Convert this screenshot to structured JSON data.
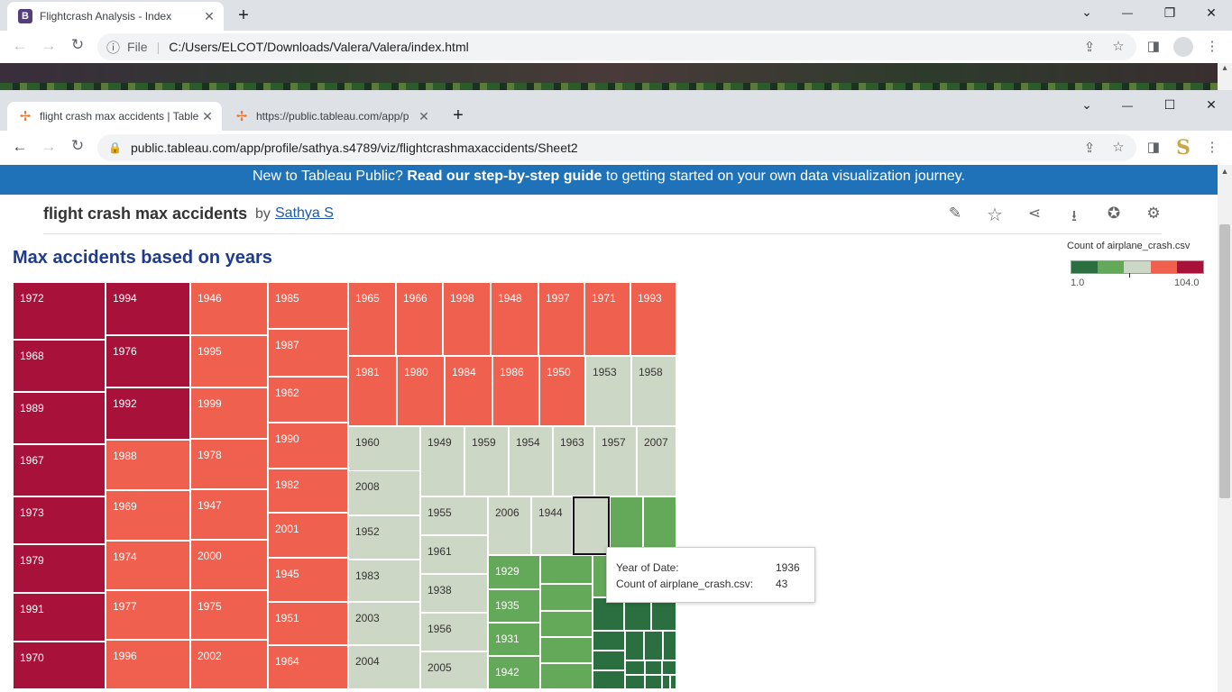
{
  "outer_window": {
    "tab": {
      "favicon": "B",
      "title": "Flightcrash Analysis - Index",
      "close": "✕"
    },
    "new_tab": "+",
    "controls": {
      "dropdown": "⌄",
      "minimize": "—",
      "restore": "❐",
      "close": "✕"
    },
    "address": {
      "info_icon": "ⓘ",
      "scheme_label": "File",
      "url": "C:/Users/ELCOT/Downloads/Valera/Valera/index.html"
    }
  },
  "inner_window": {
    "tabs": [
      {
        "title": "flight crash max accidents | Table",
        "close": "✕"
      },
      {
        "title": "https://public.tableau.com/app/p",
        "close": "✕"
      }
    ],
    "new_tab": "+",
    "controls": {
      "dropdown": "⌄",
      "minimize": "—",
      "maximize": "☐",
      "close": "✕"
    },
    "address": {
      "url": "public.tableau.com/app/profile/sathya.s4789/viz/flightcrashmaxaccidents/Sheet2"
    }
  },
  "banner": {
    "before": "New to Tableau Public? ",
    "link": "Read our step-by-step guide",
    "after": " to getting started on your own data visualization journey."
  },
  "viz_header": {
    "title": "flight crash max accidents",
    "by": "by",
    "author": "Sathya S"
  },
  "sheet_title": "Max accidents based on years",
  "legend": {
    "title": "Count of airplane_crash.csv",
    "min": "1.0",
    "max": "104.0",
    "colors": [
      "#2b6e3f",
      "#64a85a",
      "#cdd7c5",
      "#f0604f",
      "#a8123a"
    ]
  },
  "tooltip": {
    "label1": "Year of Date:",
    "value1": "1936",
    "label2": "Count of airplane_crash.csv:",
    "value2": "43"
  },
  "treemap_cells": [
    "1972",
    "1968",
    "1989",
    "1967",
    "1973",
    "1979",
    "1991",
    "1970",
    "1994",
    "1976",
    "1992",
    "1988",
    "1969",
    "1974",
    "1977",
    "1996",
    "1946",
    "1995",
    "1999",
    "1978",
    "1947",
    "2000",
    "1975",
    "2002",
    "1985",
    "1987",
    "1962",
    "1990",
    "1982",
    "2001",
    "1945",
    "1951",
    "1964",
    "1965",
    "1966",
    "1998",
    "1948",
    "1997",
    "1971",
    "1993",
    "1981",
    "1980",
    "1984",
    "1986",
    "1950",
    "1953",
    "1958",
    "1960",
    "1949",
    "1959",
    "1954",
    "1963",
    "1957",
    "2007",
    "2008",
    "1952",
    "1983",
    "2003",
    "2004",
    "1955",
    "1961",
    "1938",
    "1956",
    "2005",
    "2006",
    "1944",
    "1929",
    "1935",
    "1931",
    "1942"
  ],
  "colors": {
    "dark_red": "#a8123a",
    "red": "#f0604f",
    "light": "#cdd7c5",
    "green": "#64a85a",
    "dark_green": "#2b6e3f",
    "banner": "#1f72b8",
    "title_blue": "#1f3b8c"
  }
}
